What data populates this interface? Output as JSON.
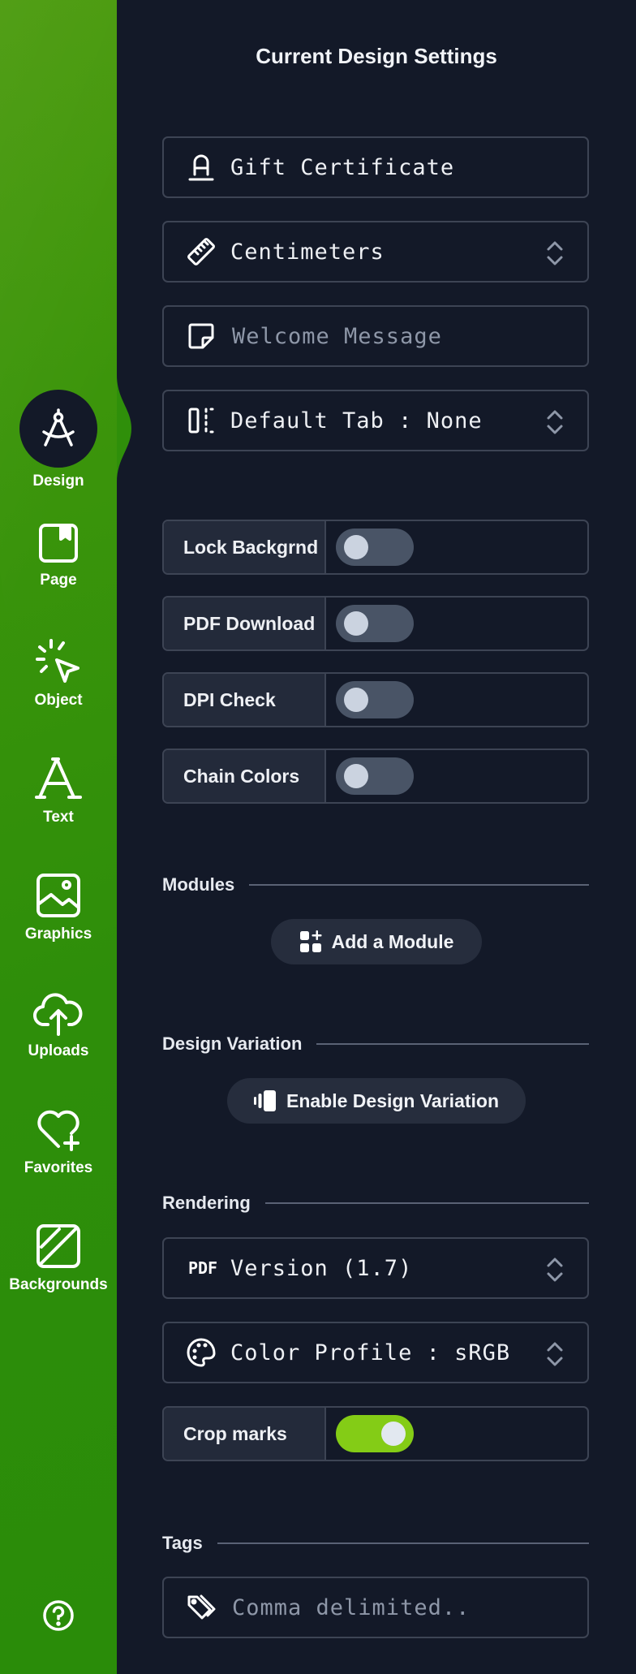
{
  "sidebar": {
    "items": [
      {
        "label": "Design",
        "icon": "compass-icon",
        "active": true
      },
      {
        "label": "Page",
        "icon": "page-icon"
      },
      {
        "label": "Object",
        "icon": "pointer-click-icon"
      },
      {
        "label": "Text",
        "icon": "text-a-icon"
      },
      {
        "label": "Graphics",
        "icon": "image-icon"
      },
      {
        "label": "Uploads",
        "icon": "cloud-upload-icon"
      },
      {
        "label": "Favorites",
        "icon": "heart-plus-icon"
      },
      {
        "label": "Backgrounds",
        "icon": "background-icon"
      }
    ],
    "help_icon": "help-circle-icon"
  },
  "main": {
    "title": "Current Design Settings",
    "fields": {
      "design_name": {
        "value": "Gift Certificate",
        "icon": "text-underline-icon"
      },
      "units": {
        "value": "Centimeters",
        "icon": "ruler-icon"
      },
      "welcome_message": {
        "placeholder": "Welcome Message",
        "icon": "sticky-note-icon"
      },
      "default_tab": {
        "value": "Default Tab : None",
        "icon": "panel-dashed-icon"
      }
    },
    "toggles": [
      {
        "label": "Lock Backgrnd",
        "on": false
      },
      {
        "label": "PDF Download",
        "on": false
      },
      {
        "label": "DPI Check",
        "on": false
      },
      {
        "label": "Chain Colors",
        "on": false
      }
    ],
    "modules": {
      "heading": "Modules",
      "button_label": "Add a Module",
      "button_icon": "apps-add-icon"
    },
    "design_variation": {
      "heading": "Design Variation",
      "button_label": "Enable Design Variation",
      "button_icon": "cards-stack-icon"
    },
    "rendering": {
      "heading": "Rendering",
      "pdf_version": {
        "value": "Version (1.7)",
        "icon_text": "PDF"
      },
      "color_profile": {
        "value": "Color Profile : sRGB",
        "icon": "palette-icon"
      },
      "crop_marks": {
        "label": "Crop marks",
        "on": true
      }
    },
    "tags": {
      "heading": "Tags",
      "placeholder": "Comma delimited..",
      "icon": "tags-icon"
    }
  },
  "colors": {
    "sidebar_green": "#2e8e0a",
    "background": "#131928",
    "accent_toggle_on": "#84cc16",
    "border": "#3d4454"
  }
}
